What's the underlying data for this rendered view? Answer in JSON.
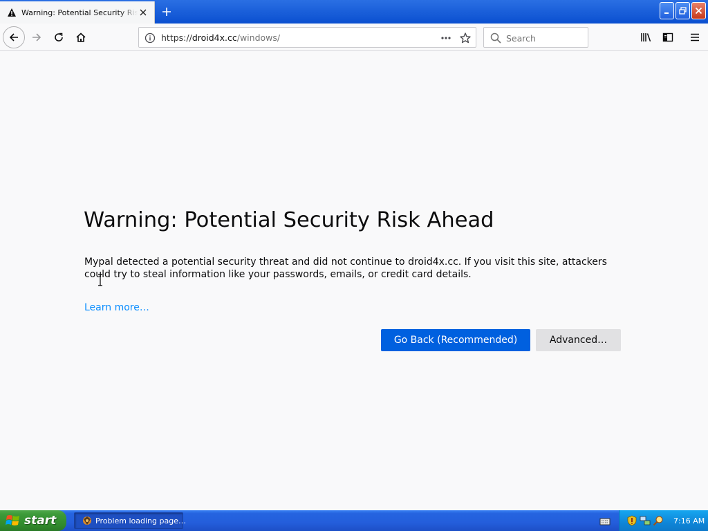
{
  "browser": {
    "tab": {
      "title": "Warning: Potential Security Risk Ahead",
      "icon": "warning-icon"
    },
    "new_tab_label": "+",
    "url": {
      "scheme": "https://",
      "domain": "droid4x.cc",
      "path": "/windows/"
    },
    "search": {
      "placeholder": "Search"
    }
  },
  "page": {
    "title": "Warning: Potential Security Risk Ahead",
    "description": "Mypal detected a potential security threat and did not continue to droid4x.cc. If you visit this site, attackers could try to steal information like your passwords, emails, or credit card details.",
    "learn_more": "Learn more…",
    "go_back_label": "Go Back (Recommended)",
    "advanced_label": "Advanced…"
  },
  "taskbar": {
    "start_label": "start",
    "task_label": "Problem loading page…",
    "clock": "7:16 AM"
  },
  "colors": {
    "primary_button": "#0060df",
    "link": "#0a8dff",
    "taskbar": "#245edb",
    "start_button": "#3c9a39",
    "tray": "#0f86d8"
  }
}
